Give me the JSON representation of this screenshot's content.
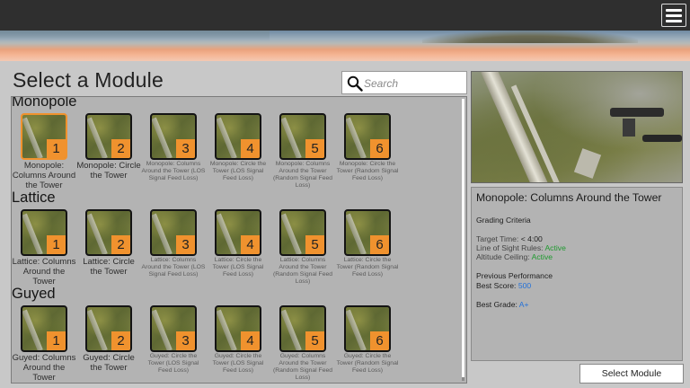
{
  "page": {
    "title": "Select a Module"
  },
  "header": {
    "menu_icon": "hamburger-menu-icon"
  },
  "search": {
    "placeholder": "Search",
    "value": "",
    "icon": "search-icon"
  },
  "categories": [
    {
      "name": "Monopole",
      "modules": [
        {
          "num": "1",
          "label": "Monopole: Columns Around the Tower",
          "selected": true
        },
        {
          "num": "2",
          "label": "Monopole: Circle the Tower"
        },
        {
          "num": "3",
          "label": "Monopole: Columns Around the Tower (LOS Signal Feed Loss)"
        },
        {
          "num": "4",
          "label": "Monopole: Circle the Tower (LOS Signal Feed Loss)"
        },
        {
          "num": "5",
          "label": "Monopole: Columns Around the Tower (Random Signal Feed Loss)"
        },
        {
          "num": "6",
          "label": "Monopole: Circle the Tower (Random Signal Feed Loss)"
        }
      ]
    },
    {
      "name": "Lattice",
      "modules": [
        {
          "num": "1",
          "label": "Lattice: Columns Around the Tower"
        },
        {
          "num": "2",
          "label": "Lattice: Circle the Tower"
        },
        {
          "num": "3",
          "label": "Lattice: Columns Around the Tower (LOS Signal Feed Loss)"
        },
        {
          "num": "4",
          "label": "Lattice: Circle the Tower (LOS Signal Feed Loss)"
        },
        {
          "num": "5",
          "label": "Lattice: Columns Around the Tower (Random Signal Feed Loss)"
        },
        {
          "num": "6",
          "label": "Lattice: Circle the Tower (Random Signal Feed Loss)"
        }
      ]
    },
    {
      "name": "Guyed",
      "modules": [
        {
          "num": "1",
          "label": "Guyed: Columns Around the Tower"
        },
        {
          "num": "2",
          "label": "Guyed: Circle the Tower"
        },
        {
          "num": "3",
          "label": "Guyed: Circle the Tower (LOS Signal Feed Loss)"
        },
        {
          "num": "4",
          "label": "Guyed: Circle the Tower (LOS Signal Feed Loss)"
        },
        {
          "num": "5",
          "label": "Guyed: Columns Around the Tower (Random Signal Feed Loss)"
        },
        {
          "num": "6",
          "label": "Guyed: Circle the Tower (Random Signal Feed Loss)"
        }
      ]
    }
  ],
  "details": {
    "title": "Monopole: Columns Around the Tower",
    "grading_heading": "Grading Criteria",
    "target_time_label": "Target Time:",
    "target_time_value": "< 4:00",
    "los_label": "Line of Sight Rules:",
    "los_value": "Active",
    "altitude_label": "Altitude Ceiling:",
    "altitude_value": "Active",
    "previous_heading": "Previous Performance",
    "best_score_label": "Best Score:",
    "best_score_value": "500",
    "best_grade_label": "Best Grade:",
    "best_grade_value": "A+"
  },
  "footer": {
    "select_button": "Select Module"
  },
  "colors": {
    "accent": "#f0922e",
    "active_green": "#1f9a2f",
    "value_blue": "#2270d8"
  }
}
